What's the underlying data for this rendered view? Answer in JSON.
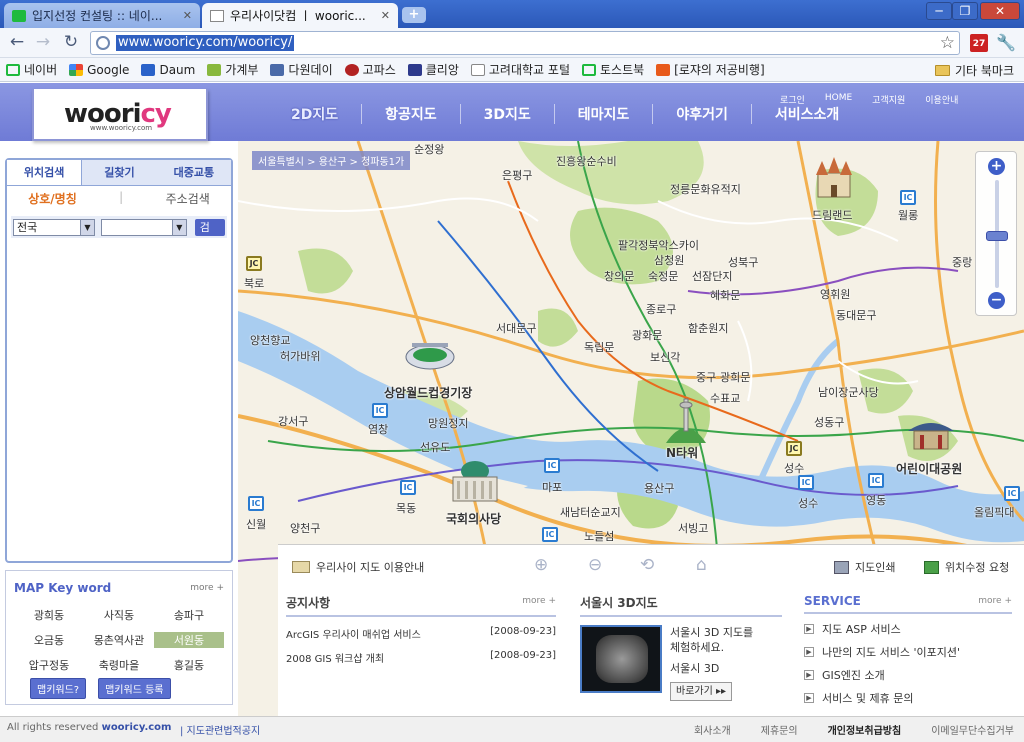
{
  "browser": {
    "tabs": [
      {
        "title": "입지선정 컨설팅 :: 네이...",
        "state": "inactive"
      },
      {
        "title": "우리사이닷컴 ㅣ wooric...",
        "state": "active"
      }
    ],
    "new_tab": "+",
    "window_buttons": {
      "minimize": "─",
      "maximize": "❐",
      "close": "✕"
    },
    "url": "www.wooricy.com/wooricy/",
    "calendar_badge": "27",
    "bookmarks": [
      {
        "label": "네이버",
        "icon": "naver-icon",
        "color": "#1fba3e"
      },
      {
        "label": "Google",
        "icon": "google-icon",
        "color": "#4285f4"
      },
      {
        "label": "Daum",
        "icon": "daum-icon",
        "color": "#2a62c9"
      },
      {
        "label": "가계부",
        "icon": "ledger-icon",
        "color": "#88b83e"
      },
      {
        "label": "다원데이",
        "icon": "dawonday-icon",
        "color": "#4a6aa8"
      },
      {
        "label": "고파스",
        "icon": "paw-icon",
        "color": "#b22222"
      },
      {
        "label": "클리앙",
        "icon": "clien-icon",
        "color": "#2e3a8c"
      },
      {
        "label": "고려대학교 포털",
        "icon": "page-icon",
        "color": "#cccccc"
      },
      {
        "label": "토스트북",
        "icon": "toastbook-icon",
        "color": "#1fba3e"
      },
      {
        "label": "[로쟈의 저공비행]",
        "icon": "blog-icon",
        "color": "#e85a1c"
      }
    ],
    "other_bookmarks": "기타 북마크"
  },
  "site": {
    "logo": {
      "main": "woori",
      "accent": "cy",
      "sub": "www.wooricy.com"
    },
    "main_nav": [
      "2D지도",
      "항공지도",
      "3D지도",
      "테마지도",
      "야후거기",
      "서비스소개"
    ],
    "util_nav": [
      "로그인",
      "HOME",
      "고객지원",
      "이용안내"
    ],
    "accent_color": "#6f7bd6"
  },
  "left_panel": {
    "tabs": [
      "위치검색",
      "길찾기",
      "대중교통"
    ],
    "sub_tabs": {
      "active": "상호/명칭",
      "other": "주소검색",
      "separator": "|"
    },
    "region_select": "전국",
    "district_select": "",
    "search_button": "검색"
  },
  "keywords": {
    "title": "MAP Key word",
    "more": "more +",
    "items": [
      "광희동",
      "사직동",
      "송파구",
      "오금동",
      "몽촌역사관",
      "서원동",
      "압구정동",
      "축령마을",
      "홍길동"
    ],
    "highlighted": "서원동",
    "buttons": [
      "맵키워드?",
      "맵키워드 등록"
    ]
  },
  "map": {
    "breadcrumb": "서울특별시 > 용산구 > 청파동1가",
    "zoom_level": 0.48,
    "labels": {
      "jinheung": "진흥왕순수비",
      "eunpyeong": "은평구",
      "jeongneung": "정릉문화유적지",
      "palgak": "팔각정북악스카이",
      "samcheong": "삼청원",
      "changui": "창의문",
      "sukjeong": "숙정문",
      "seonjam": "선잠단지",
      "seongbuk": "성북구",
      "hyehwa": "혜화문",
      "dreamland": "드림랜드",
      "seodaemun": "서대문구",
      "jongno": "종로구",
      "yeonghwi": "영휘원",
      "dongdaemun": "동대문구",
      "dongnip": "독립문",
      "gwanghwa": "광화문",
      "hamchun": "함춘원지",
      "bosin": "보신각",
      "junggu": "중구",
      "gwanghui": "광희문",
      "supyo": "수표교",
      "namdaemun": "남이장군사당",
      "yanghwa": "양천향교",
      "heojun": "허가바위",
      "sangam": "상암월드컵경기장",
      "gangseo": "강서구",
      "yeomchang": "염창",
      "mangwon": "망원정지",
      "seonyudo": "선유도",
      "ntower": "N타워",
      "seongdong": "성동구",
      "seongsu": "성수",
      "children": "어린이대공원",
      "seongsu2": "성수",
      "yeongdong": "영동",
      "mapo": "마포",
      "mokdong": "목동",
      "saenam": "새남터순교지",
      "yongsan": "용산구",
      "nationalassembly": "국회의사당",
      "singwol": "신월",
      "yangcheon": "양천구",
      "seobinggo": "서빙고",
      "nodeul": "노들섬",
      "olympic": "올림픽대",
      "bukno": "북로",
      "wolgye": "월롱",
      "jungnang": "중랑",
      "sunjeong": "순정왕"
    }
  },
  "map_toolbar": {
    "guide": "우리사이 지도 이용안내",
    "print": "지도인쇄",
    "report": "위치수정 요청"
  },
  "info": {
    "notice": {
      "title": "공지사항",
      "more": "more +",
      "items": [
        {
          "text": "ArcGIS 우리사이 매쉬업 서비스",
          "date": "[2008-09-23]"
        },
        {
          "text": "2008 GIS 워크샵 개최",
          "date": "[2008-09-23]"
        }
      ]
    },
    "seoul3d": {
      "title": "서울시 3D지도",
      "desc1": "서울시 3D 지도를",
      "desc2": "체험하세요.",
      "label": "서울시 3D",
      "button": "바로가기 ▸▸"
    },
    "service": {
      "title": "SERVICE",
      "more": "more +",
      "items": [
        "지도 ASP 서비스",
        "나만의 지도 서비스 '이포지션'",
        "GIS엔진 소개",
        "서비스 및 제휴 문의"
      ]
    }
  },
  "footer": {
    "copyright_prefix": "All rights reserved ",
    "copyright_site": "wooricy.com",
    "legal": "| 지도관련법적공지",
    "links": [
      "회사소개",
      "제휴문의",
      "개인정보취급방침",
      "이메일무단수집거부"
    ]
  }
}
